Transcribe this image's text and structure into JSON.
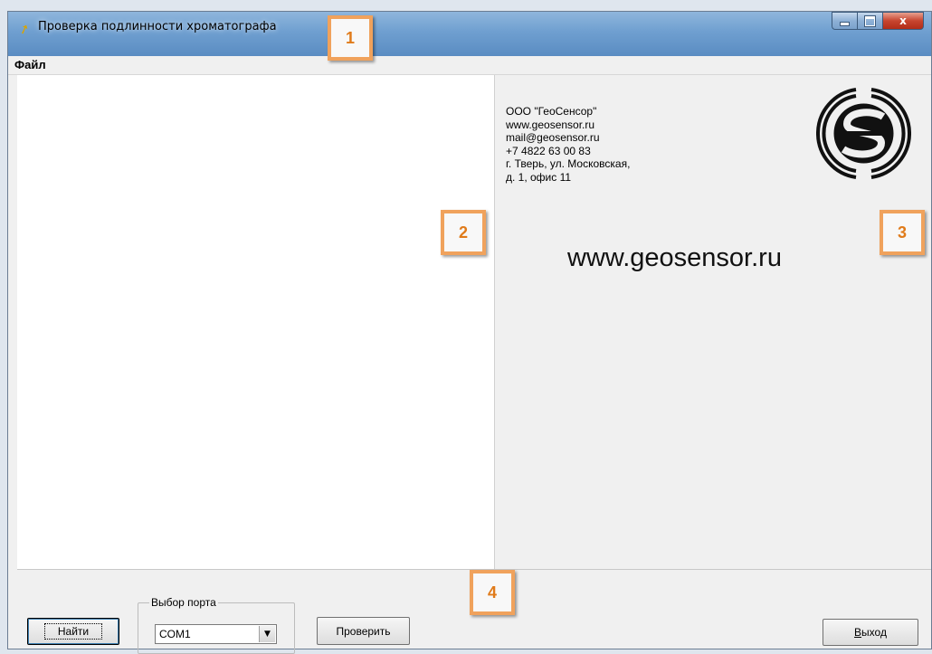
{
  "window": {
    "title": "Проверка подлинности хроматографа",
    "controls": {
      "minimize": "minimize",
      "maximize": "maximize",
      "close": "x"
    }
  },
  "menu": {
    "items": [
      "Файл"
    ]
  },
  "info": {
    "company": "ООО \"ГеоСенсор\"",
    "website": "www.geosensor.ru",
    "email": "mail@geosensor.ru",
    "phone": "+7 4822 63 00 83",
    "address_line1": "г. Тверь, ул. Московская,",
    "address_line2": "д. 1, офис 11",
    "big_url": "www.geosensor.ru",
    "logo": "geosensor-logo"
  },
  "bottom": {
    "find_button": "Найти",
    "port_group_label": "Выбор порта",
    "port_selected": "COM1",
    "check_button": "Проверить",
    "exit_button_accel": "В",
    "exit_button_rest": "ыход"
  },
  "callouts": [
    "1",
    "2",
    "3",
    "4"
  ],
  "colors": {
    "callout_border": "#f0a25c",
    "callout_text": "#e07b1a"
  }
}
